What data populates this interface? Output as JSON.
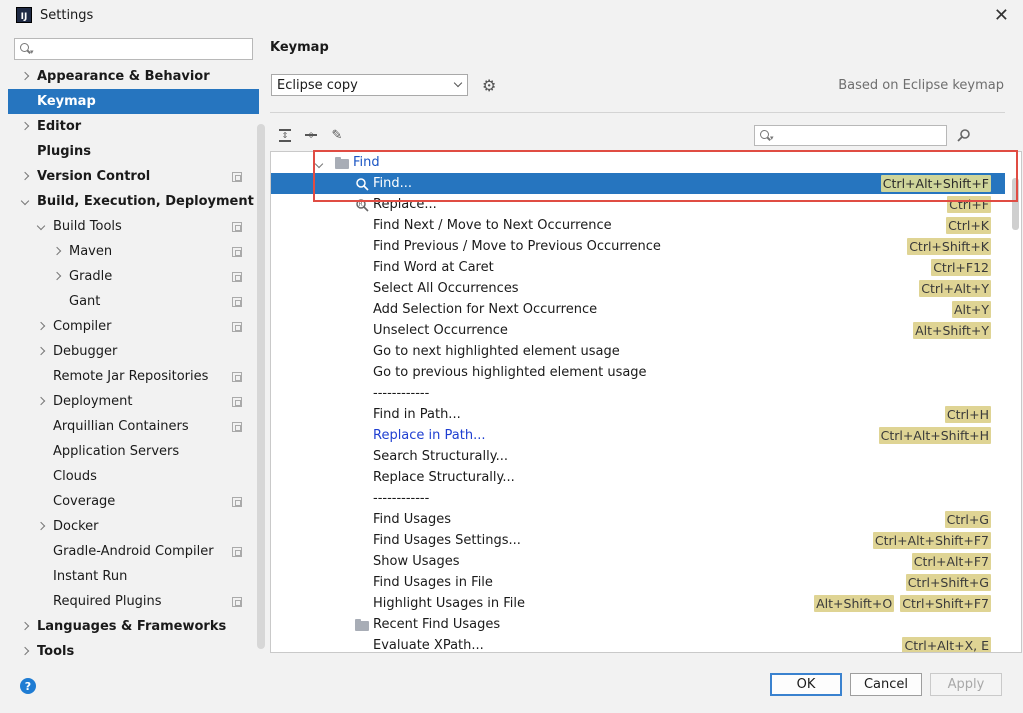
{
  "window": {
    "title": "Settings",
    "app_icon_text": "IJ"
  },
  "sidebar": {
    "search_placeholder": "",
    "items": [
      {
        "label": "Appearance & Behavior",
        "level": 0,
        "arrow": "right",
        "bold": true,
        "project": false,
        "selected": false
      },
      {
        "label": "Keymap",
        "level": 0,
        "arrow": "none",
        "bold": true,
        "project": false,
        "selected": true
      },
      {
        "label": "Editor",
        "level": 0,
        "arrow": "right",
        "bold": true,
        "project": false,
        "selected": false
      },
      {
        "label": "Plugins",
        "level": 0,
        "arrow": "none",
        "bold": true,
        "project": false,
        "selected": false
      },
      {
        "label": "Version Control",
        "level": 0,
        "arrow": "right",
        "bold": true,
        "project": true,
        "selected": false
      },
      {
        "label": "Build, Execution, Deployment",
        "level": 0,
        "arrow": "down",
        "bold": true,
        "project": false,
        "selected": false
      },
      {
        "label": "Build Tools",
        "level": 1,
        "arrow": "down",
        "bold": false,
        "project": true,
        "selected": false
      },
      {
        "label": "Maven",
        "level": 2,
        "arrow": "right",
        "bold": false,
        "project": true,
        "selected": false
      },
      {
        "label": "Gradle",
        "level": 2,
        "arrow": "right",
        "bold": false,
        "project": true,
        "selected": false
      },
      {
        "label": "Gant",
        "level": 2,
        "arrow": "none",
        "bold": false,
        "project": true,
        "selected": false
      },
      {
        "label": "Compiler",
        "level": 1,
        "arrow": "right",
        "bold": false,
        "project": true,
        "selected": false
      },
      {
        "label": "Debugger",
        "level": 1,
        "arrow": "right",
        "bold": false,
        "project": false,
        "selected": false
      },
      {
        "label": "Remote Jar Repositories",
        "level": 1,
        "arrow": "none",
        "bold": false,
        "project": true,
        "selected": false
      },
      {
        "label": "Deployment",
        "level": 1,
        "arrow": "right",
        "bold": false,
        "project": true,
        "selected": false
      },
      {
        "label": "Arquillian Containers",
        "level": 1,
        "arrow": "none",
        "bold": false,
        "project": true,
        "selected": false
      },
      {
        "label": "Application Servers",
        "level": 1,
        "arrow": "none",
        "bold": false,
        "project": false,
        "selected": false
      },
      {
        "label": "Clouds",
        "level": 1,
        "arrow": "none",
        "bold": false,
        "project": false,
        "selected": false
      },
      {
        "label": "Coverage",
        "level": 1,
        "arrow": "none",
        "bold": false,
        "project": true,
        "selected": false
      },
      {
        "label": "Docker",
        "level": 1,
        "arrow": "right",
        "bold": false,
        "project": false,
        "selected": false
      },
      {
        "label": "Gradle-Android Compiler",
        "level": 1,
        "arrow": "none",
        "bold": false,
        "project": true,
        "selected": false
      },
      {
        "label": "Instant Run",
        "level": 1,
        "arrow": "none",
        "bold": false,
        "project": false,
        "selected": false
      },
      {
        "label": "Required Plugins",
        "level": 1,
        "arrow": "none",
        "bold": false,
        "project": true,
        "selected": false
      },
      {
        "label": "Languages & Frameworks",
        "level": 0,
        "arrow": "right",
        "bold": true,
        "project": false,
        "selected": false
      },
      {
        "label": "Tools",
        "level": 0,
        "arrow": "right",
        "bold": true,
        "project": false,
        "selected": false
      }
    ]
  },
  "main": {
    "title": "Keymap",
    "keymap_selected": "Eclipse copy",
    "based_on": "Based on Eclipse keymap",
    "shortcut_search_placeholder": ""
  },
  "actions": [
    {
      "label": "Find",
      "type": "group",
      "icon": "folder",
      "keys": []
    },
    {
      "label": "Find...",
      "type": "item",
      "icon": "search",
      "keys": [
        "Ctrl+Alt+Shift+F"
      ],
      "selected": true
    },
    {
      "label": "Replace...",
      "type": "item",
      "icon": "replace",
      "keys": [
        "Ctrl+F"
      ]
    },
    {
      "label": "Find Next / Move to Next Occurrence",
      "type": "item",
      "keys": [
        "Ctrl+K"
      ]
    },
    {
      "label": "Find Previous / Move to Previous Occurrence",
      "type": "item",
      "keys": [
        "Ctrl+Shift+K"
      ]
    },
    {
      "label": "Find Word at Caret",
      "type": "item",
      "keys": [
        "Ctrl+F12"
      ]
    },
    {
      "label": "Select All Occurrences",
      "type": "item",
      "keys": [
        "Ctrl+Alt+Y"
      ]
    },
    {
      "label": "Add Selection for Next Occurrence",
      "type": "item",
      "keys": [
        "Alt+Y"
      ]
    },
    {
      "label": "Unselect Occurrence",
      "type": "item",
      "keys": [
        "Alt+Shift+Y"
      ]
    },
    {
      "label": "Go to next highlighted element usage",
      "type": "item",
      "keys": []
    },
    {
      "label": "Go to previous highlighted element usage",
      "type": "item",
      "keys": []
    },
    {
      "label": "------------",
      "type": "item",
      "keys": []
    },
    {
      "label": "Find in Path...",
      "type": "item",
      "keys": [
        "Ctrl+H"
      ]
    },
    {
      "label": "Replace in Path...",
      "type": "link",
      "keys": [
        "Ctrl+Alt+Shift+H"
      ]
    },
    {
      "label": "Search Structurally...",
      "type": "item",
      "keys": []
    },
    {
      "label": "Replace Structurally...",
      "type": "item",
      "keys": []
    },
    {
      "label": "------------",
      "type": "item",
      "keys": []
    },
    {
      "label": "Find Usages",
      "type": "item",
      "keys": [
        "Ctrl+G"
      ]
    },
    {
      "label": "Find Usages Settings...",
      "type": "item",
      "keys": [
        "Ctrl+Alt+Shift+F7"
      ]
    },
    {
      "label": "Show Usages",
      "type": "item",
      "keys": [
        "Ctrl+Alt+F7"
      ]
    },
    {
      "label": "Find Usages in File",
      "type": "item",
      "keys": [
        "Ctrl+Shift+G"
      ]
    },
    {
      "label": "Highlight Usages in File",
      "type": "item",
      "keys": [
        "Alt+Shift+O",
        "Ctrl+Shift+F7"
      ]
    },
    {
      "label": "Recent Find Usages",
      "type": "item",
      "icon": "folder",
      "keys": []
    },
    {
      "label": "Evaluate XPath...",
      "type": "item",
      "keys": [
        "Ctrl+Alt+X, E"
      ]
    }
  ],
  "buttons": {
    "ok": "OK",
    "cancel": "Cancel",
    "apply": "Apply",
    "help": "?"
  },
  "colors": {
    "selection": "#2675bf",
    "key_badge": "#dfd494",
    "highlight_box": "#e04c43",
    "link": "#1f3fd1"
  }
}
